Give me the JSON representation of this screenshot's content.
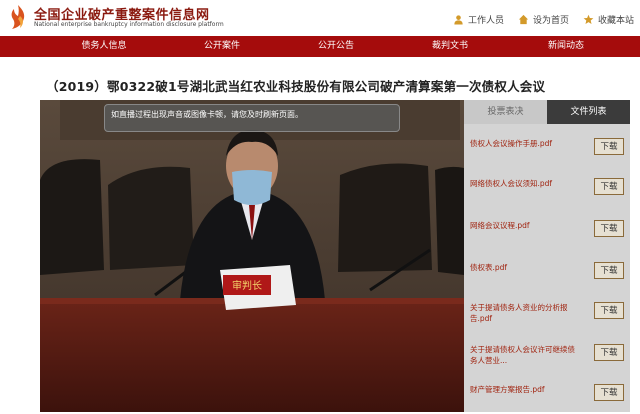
{
  "header": {
    "title": "全国企业破产重整案件信息网",
    "subtitle": "National enterprise bankruptcy information disclosure platform",
    "links": [
      {
        "label": "工作人员",
        "icon": "user-icon"
      },
      {
        "label": "设为首页",
        "icon": "home-icon"
      },
      {
        "label": "收藏本站",
        "icon": "star-icon"
      }
    ]
  },
  "nav": {
    "items": [
      "债务人信息",
      "公开案件",
      "公开公告",
      "裁判文书",
      "新闻动态"
    ]
  },
  "case": {
    "title": "（2019）鄂0322破1号湖北武当红农业科技股份有限公司破产清算案第一次债权人会议"
  },
  "video": {
    "notice": "如直播过程出现声音或图像卡顿，请您及时刷新页面。",
    "nameplate": "审判长"
  },
  "panel": {
    "tabs": [
      "投票表决",
      "文件列表"
    ],
    "active_tab": "文件列表",
    "download_label": "下载",
    "files": [
      "债权人会议操作手册.pdf",
      "网络债权人会议须知.pdf",
      "网络会议议程.pdf",
      "债权表.pdf",
      "关于提请债务人资业的分析报告.pdf",
      "关于提请债权人会议许可继续债务人营业...",
      "财产管理方案报告.pdf"
    ]
  },
  "colors": {
    "nav_bg": "#a50c0c",
    "title_red": "#8b1a10",
    "file_link": "#a0230f",
    "tab_active": "#3b3b3b"
  }
}
